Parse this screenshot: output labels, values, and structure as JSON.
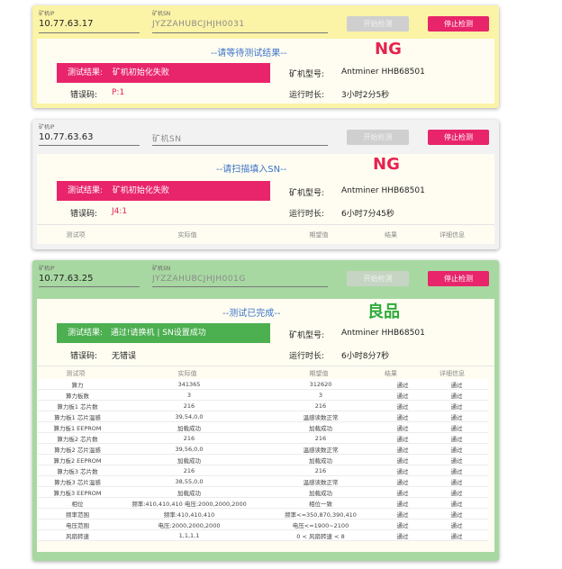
{
  "labels": {
    "ip": "矿机IP",
    "sn": "矿机SN",
    "result": "测试结果:",
    "error_code": "错误码:",
    "model": "矿机型号:",
    "runtime": "运行时长:"
  },
  "buttons": {
    "start": "开始检测",
    "stop": "停止检测"
  },
  "table_headers": [
    "测试项",
    "实际值",
    "期望值",
    "结果",
    "详细信息"
  ],
  "cards": [
    {
      "ip": "10.77.63.17",
      "sn": "JYZZAHUBCJHJH0031",
      "message": "--请等待测试结果--",
      "verdict": "NG",
      "result_text": "矿机初始化失败",
      "error_code": "P:1",
      "model": "Antminer HHB68501",
      "runtime": "3小时2分5秒"
    },
    {
      "ip": "10.77.63.63",
      "sn_placeholder": "矿机SN",
      "message": "--请扫描填入SN--",
      "verdict": "NG",
      "result_text": "矿机初始化失败",
      "error_code": "J4:1",
      "model": "Antminer HHB68501",
      "runtime": "6小时7分45秒"
    },
    {
      "ip": "10.77.63.25",
      "sn": "JYZZAHUBCJHJH001G",
      "message": "--测试已完成--",
      "verdict": "良品",
      "result_text": "通过!请换机 | SN设置成功",
      "error_code": "无错误",
      "model": "Antminer HHB68501",
      "runtime": "6小时8分7秒"
    }
  ],
  "status_colors": {
    "waiting_bg": "#fbf3a6",
    "idle_bg": "#f2f2f2",
    "done_bg": "#a8d8a2",
    "stop_button": "#e8256b",
    "fail": "#e5234f",
    "pass": "#2eaa3c"
  },
  "results_table": [
    [
      "算力",
      "341365",
      "312620",
      "通过",
      "通过"
    ],
    [
      "算力板数",
      "3",
      "3",
      "通过",
      "通过"
    ],
    [
      "算力板1 芯片数",
      "216",
      "216",
      "通过",
      "通过"
    ],
    [
      "算力板1 芯片温感",
      "39,54,0,0",
      "温感读数正常",
      "通过",
      "通过"
    ],
    [
      "算力板1 EEPROM",
      "加载成功",
      "加载成功",
      "通过",
      "通过"
    ],
    [
      "算力板2 芯片数",
      "216",
      "216",
      "通过",
      "通过"
    ],
    [
      "算力板2 芯片温感",
      "39,56,0,0",
      "温感读数正常",
      "通过",
      "通过"
    ],
    [
      "算力板2 EEPROM",
      "加载成功",
      "加载成功",
      "通过",
      "通过"
    ],
    [
      "算力板3 芯片数",
      "216",
      "216",
      "通过",
      "通过"
    ],
    [
      "算力板3 芯片温感",
      "38,55,0,0",
      "温感读数正常",
      "通过",
      "通过"
    ],
    [
      "算力板3 EEPROM",
      "加载成功",
      "加载成功",
      "通过",
      "通过"
    ],
    [
      "相位",
      "频率:410,410,410 电压:2000,2000,2000",
      "相位一致",
      "通过",
      "通过"
    ],
    [
      "频率范围",
      "频率:410,410,410",
      "频率<=350,870,390,410",
      "通过",
      "通过"
    ],
    [
      "电压范围",
      "电压:2000,2000,2000",
      "电压<=1900~2100",
      "通过",
      "通过"
    ],
    [
      "风扇转速",
      "1,1,1,1",
      "0 < 风扇转速 < 8",
      "通过",
      "通过"
    ]
  ]
}
